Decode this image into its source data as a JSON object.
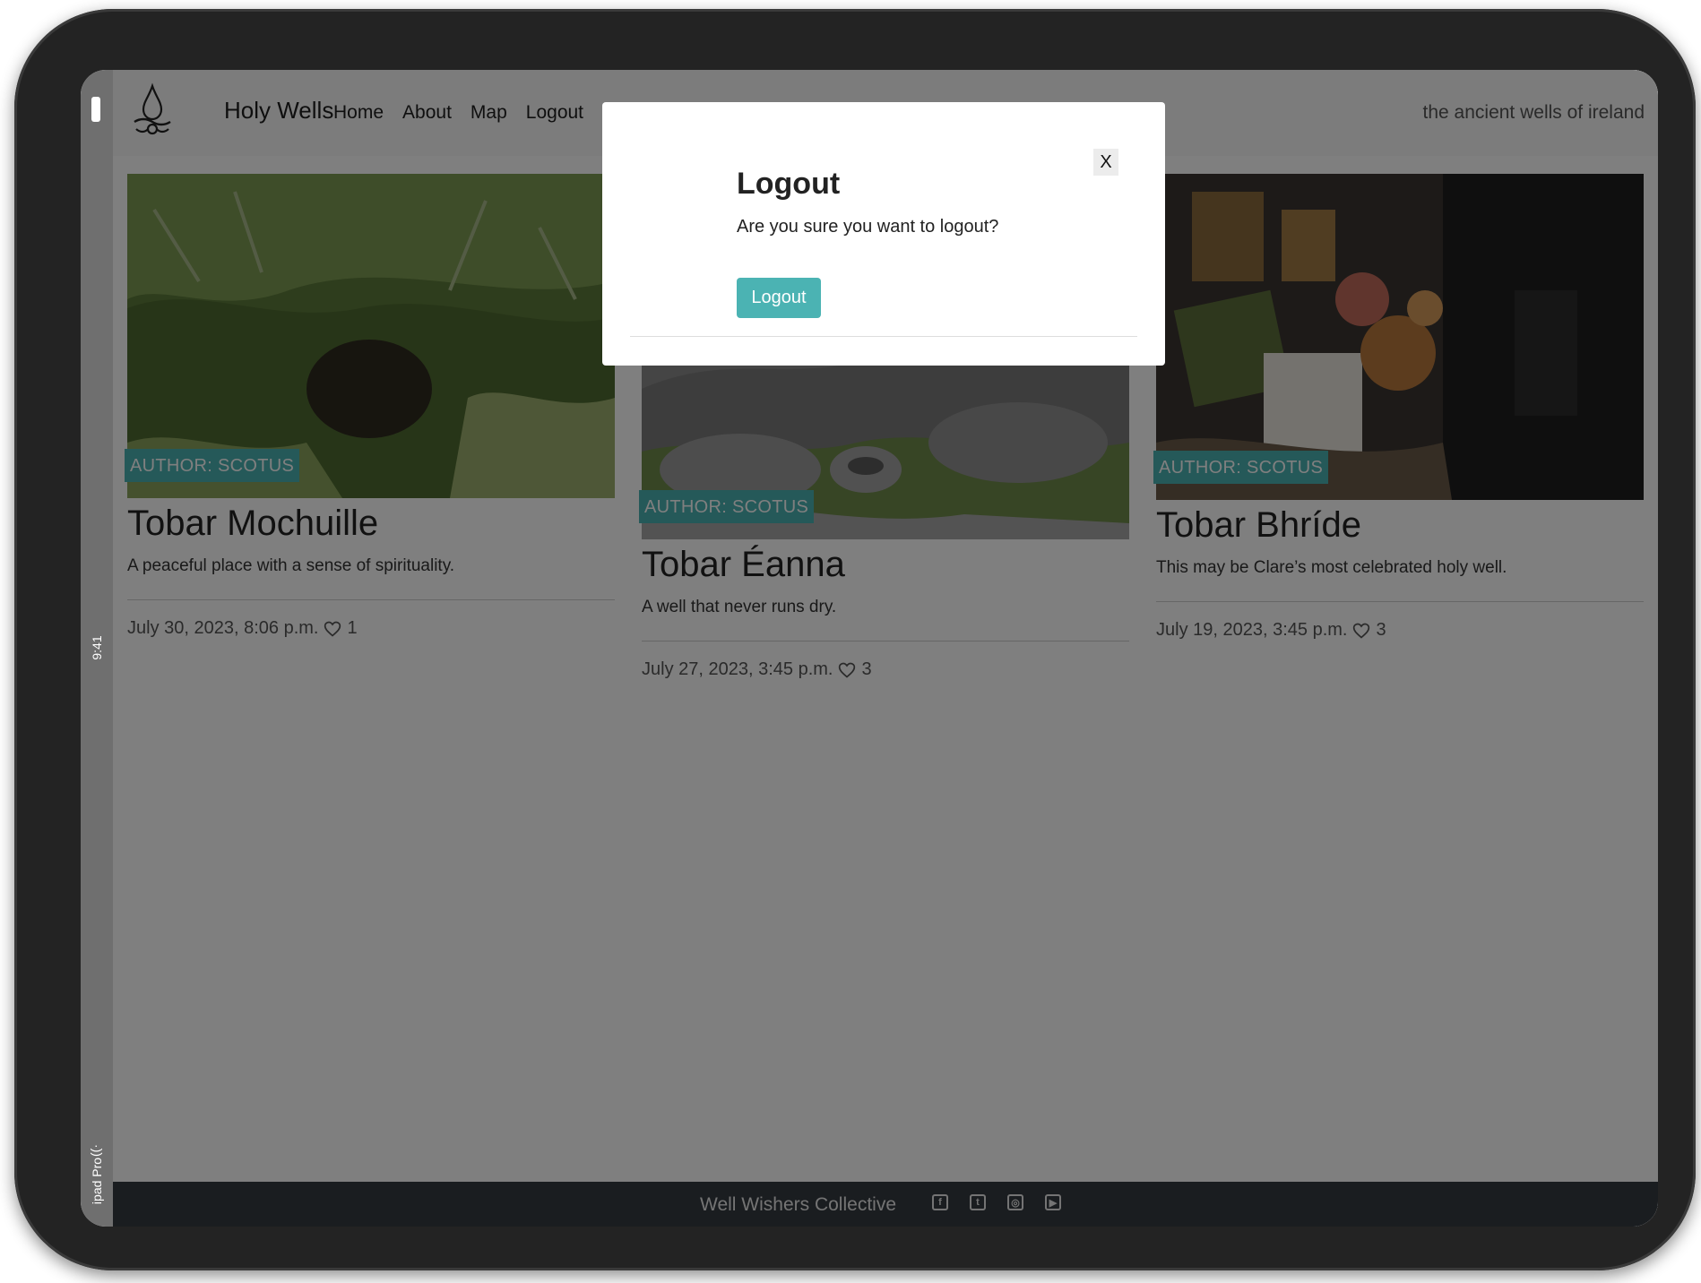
{
  "device": {
    "status_time": "9:41",
    "device_label": "ipad Pro"
  },
  "navbar": {
    "brand": "Holy Wells",
    "links": [
      "Home",
      "About",
      "Map",
      "Logout"
    ],
    "tagline": "the ancient wells of ireland"
  },
  "cards": [
    {
      "author": "AUTHOR: SCOTUS",
      "title": "Tobar Mochuille",
      "description": "A peaceful place with a sense of spirituality.",
      "date": "July 30, 2023, 8:06 p.m.",
      "likes": "1"
    },
    {
      "author": "AUTHOR: SCOTUS",
      "title": "Tobar Éanna",
      "description": "A well that never runs dry.",
      "date": "July 27, 2023, 3:45 p.m.",
      "likes": "3"
    },
    {
      "author": "AUTHOR: SCOTUS",
      "title": "Tobar Bhríde",
      "description": "This may be Clare’s most celebrated holy well.",
      "date": "July 19, 2023, 3:45 p.m.",
      "likes": "3"
    }
  ],
  "footer": {
    "text": "Well Wishers Collective",
    "social_icons": [
      "facebook-icon",
      "twitter-icon",
      "instagram-icon",
      "youtube-icon"
    ]
  },
  "modal": {
    "close_label": "X",
    "title": "Logout",
    "body": "Are you sure you want to logout?",
    "confirm_label": "Logout"
  },
  "colors": {
    "accent": "#4bb3b3",
    "footer_bg": "#343a40",
    "navbar_bg": "#f8f8f8"
  }
}
